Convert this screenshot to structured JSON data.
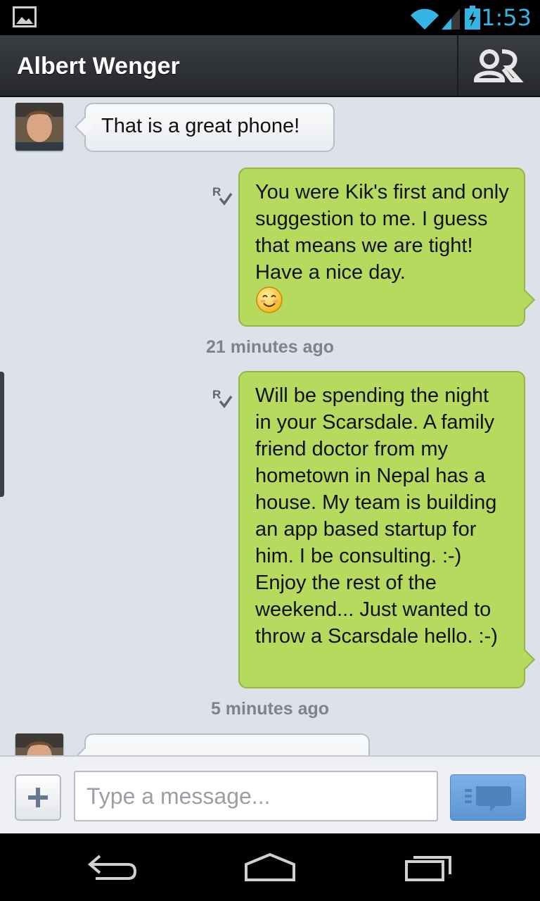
{
  "status_bar": {
    "time": "1:53",
    "icons": [
      "gallery-icon",
      "wifi-icon",
      "cell-signal-icon",
      "battery-charging-icon"
    ],
    "accent_color": "#33b5e5"
  },
  "header": {
    "contact_name": "Albert Wenger",
    "profile_icon": "contact-profile-icon"
  },
  "messages": [
    {
      "direction": "incoming",
      "text": "That is a great phone!"
    },
    {
      "direction": "outgoing",
      "text": "You were Kik's first and only suggestion to me. I guess that means we are tight! Have a nice day.",
      "emoji": "smiling-face-emoji",
      "receipt": "R"
    },
    {
      "direction": "outgoing",
      "text": "Will be spending the night in your Scarsdale. A family friend doctor from my hometown in Nepal has a house. My team is building an app based startup for him. I be consulting. :-) Enjoy the rest of the weekend... Just wanted to throw a Scarsdale hello. :-)",
      "receipt": "R"
    },
    {
      "direction": "incoming",
      "text": ""
    }
  ],
  "timestamps": [
    "21 minutes ago",
    "5 minutes ago"
  ],
  "composer": {
    "placeholder": "Type a message...",
    "add_icon": "plus-icon",
    "send_icon": "send-message-icon"
  },
  "nav_bar": {
    "icons": [
      "back-icon",
      "home-icon",
      "recent-apps-icon"
    ]
  },
  "colors": {
    "outgoing_bubble": "#b6da5e",
    "incoming_bubble": "#f5f6f8",
    "chat_background": "#dde2ea",
    "send_button": "#6aa3dd"
  }
}
